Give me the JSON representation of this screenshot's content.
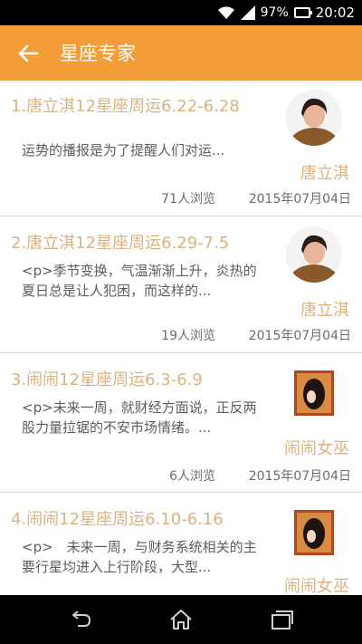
{
  "status_bar": {
    "battery": "97%",
    "battery_level": 0.97,
    "time": "20:02",
    "icons": [
      "wifi-icon",
      "signal-icon",
      "battery-icon"
    ]
  },
  "app_bar": {
    "title": "星座专家",
    "back_icon": "arrow-left-icon",
    "color": "#f29d38"
  },
  "accent_colors": {
    "title_text": "#dcb27f",
    "body_text": "#5d5d5d"
  },
  "articles": [
    {
      "title": "1.唐立淇12星座周运6.22-6.28",
      "summary": "运势的播报是为了提醒人们对运...",
      "author": "唐立淇",
      "views": "71人浏览",
      "date": "2015年07月04日"
    },
    {
      "title": "2.唐立淇12星座周运6.29-7.5",
      "summary": "<p>季节变换，气温渐渐上升，炎热的夏日总是让人犯困，而这样的...",
      "author": "唐立淇",
      "views": "19人浏览",
      "date": "2015年07月04日"
    },
    {
      "title": "3.闹闹12星座周运6.3-6.9",
      "summary": "<p>未来一周，就财经方面说，正反两股力量拉锯的不安市场情绪。...",
      "author": "闹闹女巫",
      "views": "6人浏览",
      "date": "2015年07月04日"
    },
    {
      "title": "4.闹闹12星座周运6.10-6.16",
      "summary": "<p>　未来一周，与财务系统相关的主要行星均进入上行阶段，大型...",
      "author": "闹闹女巫"
    }
  ],
  "nav_bar": {
    "icons": [
      "back-nav-icon",
      "home-icon",
      "recent-apps-icon"
    ]
  }
}
